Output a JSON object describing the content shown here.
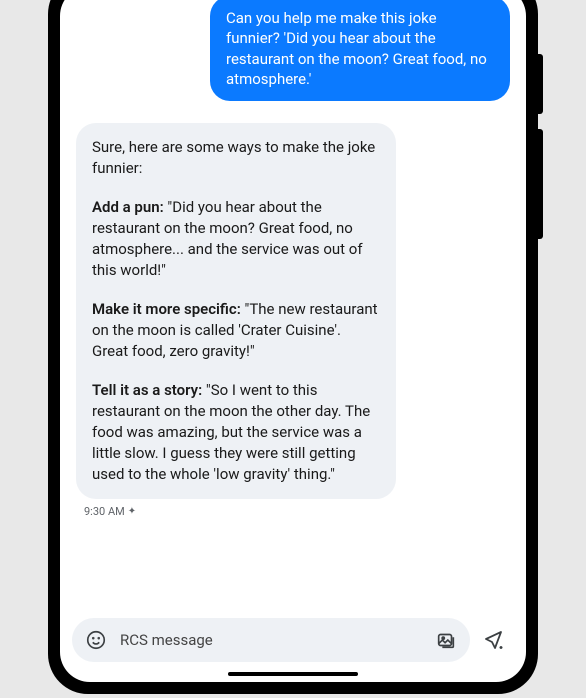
{
  "chat": {
    "outgoing": "Can you help me make this joke funnier? 'Did you hear about the restaurant on the moon? Great food, no atmosphere.'",
    "incoming": {
      "intro": "Sure, here are some ways to make the joke funnier:",
      "sections": [
        {
          "title": "Add a pun:",
          "text": " \"Did you hear about the restaurant on the moon? Great food, no atmosphere... and the service was out of this world!\""
        },
        {
          "title": "Make it more specific:",
          "text": " \"The new restaurant on the moon is called 'Crater Cuisine'. Great food, zero gravity!\""
        },
        {
          "title": "Tell it as a story:",
          "text": " \"So I went to this restaurant on the moon the other day. The food was amazing, but the service was a little slow. I guess they were still getting used to the whole 'low gravity' thing.\""
        }
      ]
    },
    "timestamp": "9:30 AM"
  },
  "composer": {
    "placeholder": "RCS message"
  }
}
